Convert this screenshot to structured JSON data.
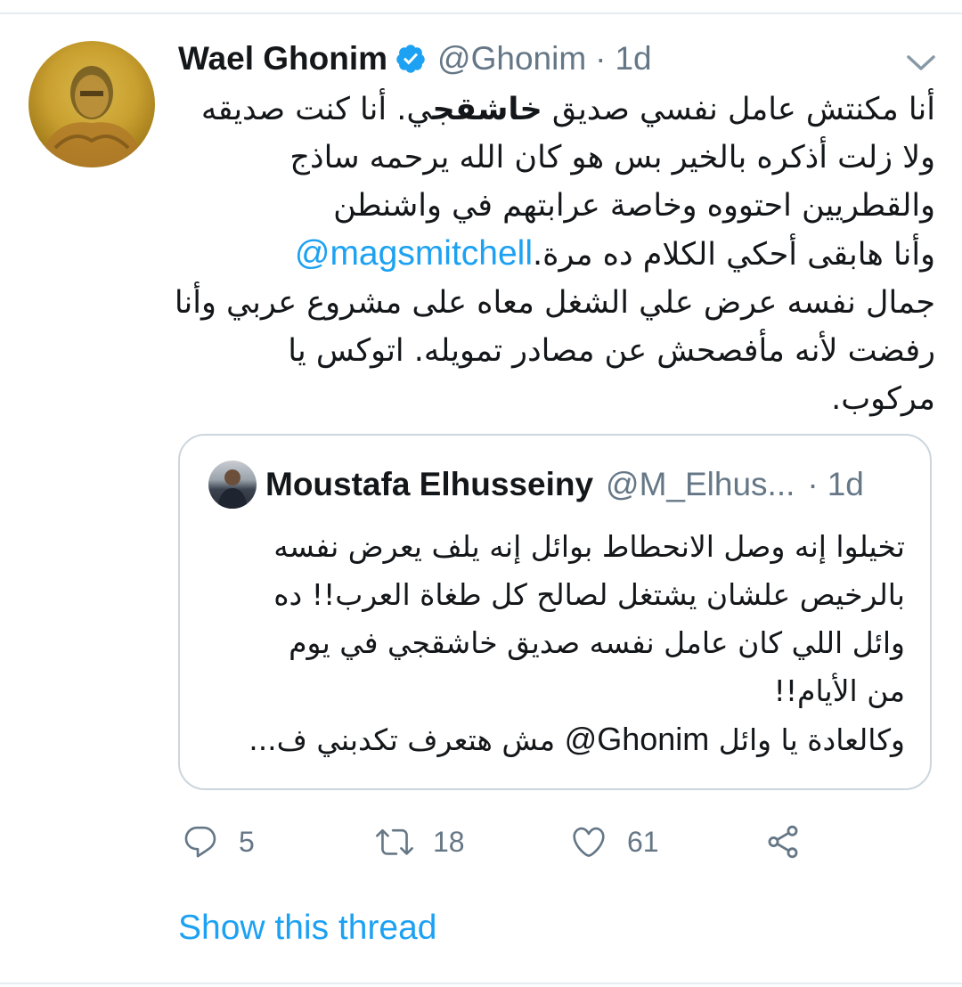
{
  "tweet": {
    "author_name": "Wael Ghonim",
    "verified": true,
    "handle": "@Ghonim",
    "separator": "·",
    "time": "1d",
    "lines": [
      {
        "prefix": "أنا مكنتش عامل نفسي صديق ",
        "bold": "خاشقج",
        "suffix": "ي. أنا كنت صديقه"
      },
      {
        "text": "ولا زلت أذكره بالخير بس هو كان الله يرحمه ساذج"
      },
      {
        "text": "والقطريين احتووه وخاصة عرابتهم في واشنطن"
      },
      {
        "mention": "@magsmitchell",
        "text": " وأنا هابقى أحكي الكلام ده مرة."
      },
      {
        "text": "جمال نفسه عرض علي الشغل معاه على مشروع عربي وأنا"
      },
      {
        "text": "رفضت لأنه مأفصحش عن مصادر تمويله. اتوكس يا"
      },
      {
        "text": "مركوب."
      }
    ]
  },
  "quoted": {
    "author_name": "Moustafa Elhusseiny",
    "handle": "@M_Elhus...",
    "separator": "·",
    "time": "1d",
    "lines": [
      {
        "text": "تخيلوا إنه وصل الانحطاط بوائل إنه يلف يعرض نفسه"
      },
      {
        "text": "بالرخيص علشان يشتغل لصالح كل طغاة العرب!! ده"
      },
      {
        "text": "وائل اللي كان عامل نفسه صديق خاشقجي في يوم"
      },
      {
        "text": "من الأيام!!"
      },
      {
        "prefix": "وكالعادة يا وائل ",
        "latin": "@Ghonim",
        "suffix": " مش هتعرف تكدبني ف..."
      }
    ]
  },
  "actions": {
    "reply": {
      "icon": "reply-icon",
      "count": "5"
    },
    "retweet": {
      "icon": "retweet-icon",
      "count": "18"
    },
    "like": {
      "icon": "heart-icon",
      "count": "61"
    },
    "share": {
      "icon": "share-icon"
    }
  },
  "show_thread_label": "Show this thread",
  "colors": {
    "accent": "#1da1f2",
    "secondary_text": "#657786",
    "border": "#ccd6dd"
  }
}
